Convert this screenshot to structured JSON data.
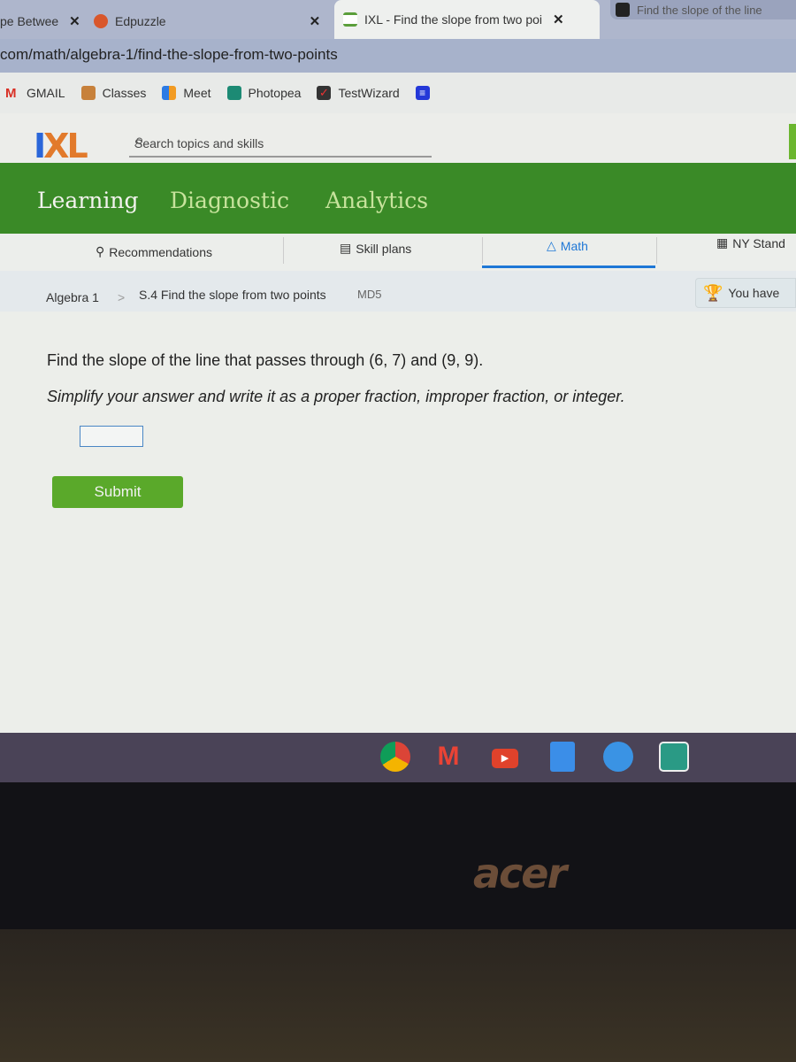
{
  "browser": {
    "tabs": [
      {
        "label": "pe Betwee",
        "icon": "page-icon"
      },
      {
        "label": "Edpuzzle",
        "icon": "edpuzzle-icon"
      },
      {
        "label": "IXL - Find the slope from two poi",
        "icon": "ixl-icon",
        "active": true
      },
      {
        "label": "Find the slope of the line",
        "icon": "bartleby-icon"
      }
    ],
    "close_glyph": "✕",
    "address": "com/math/algebra-1/find-the-slope-from-two-points",
    "bookmarks": [
      {
        "label": "GMAIL",
        "icon": "gmail-icon"
      },
      {
        "label": "Classes",
        "icon": "classroom-icon"
      },
      {
        "label": "Meet",
        "icon": "meet-icon"
      },
      {
        "label": "Photopea",
        "icon": "photopea-icon"
      },
      {
        "label": "TestWizard",
        "icon": "testwizard-icon"
      }
    ]
  },
  "ixl": {
    "logo_i": "I",
    "logo_xl": "XL",
    "search_placeholder": "Search topics and skills",
    "search_icon": "⌕",
    "main_nav": [
      "Learning",
      "Diagnostic",
      "Analytics"
    ],
    "sub_nav": [
      "Recommendations",
      "Skill plans",
      "Math",
      "NY Stand"
    ],
    "breadcrumb": {
      "subject": "Algebra 1",
      "separator": ">",
      "skill": "S.4 Find the slope from two points",
      "code": "MD5"
    },
    "badge_text": "You have",
    "colors": {
      "green_nav": "#3a8a27",
      "submit": "#5aa92a",
      "accent_blue": "#1e77d6"
    }
  },
  "question": {
    "prompt": "Find the slope of the line that passes through (6, 7) and (9, 9).",
    "instructions": "Simplify your answer and write it as a proper fraction, improper fraction, or integer.",
    "answer_value": "",
    "submit_label": "Submit"
  },
  "shelf": [
    "chrome-icon",
    "gmail-icon",
    "youtube-icon",
    "docs-icon",
    "files-icon",
    "photopea-icon"
  ],
  "bezel_brand": "acer"
}
